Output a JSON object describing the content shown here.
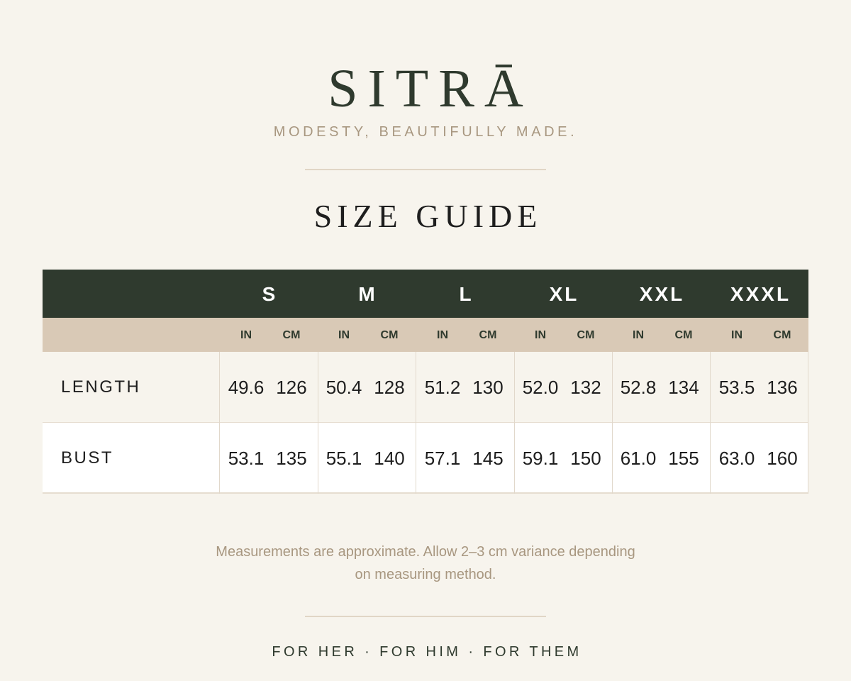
{
  "brand": {
    "name": "SITRĀ",
    "tagline": "MODESTY, BEAUTIFULLY MADE."
  },
  "page_title": "SIZE GUIDE",
  "table": {
    "sizes": [
      "S",
      "M",
      "L",
      "XL",
      "XXL",
      "XXXL"
    ],
    "units": {
      "in": "IN",
      "cm": "CM"
    },
    "rows": [
      {
        "label": "LENGTH",
        "values": [
          {
            "in": "49.6",
            "cm": "126"
          },
          {
            "in": "50.4",
            "cm": "128"
          },
          {
            "in": "51.2",
            "cm": "130"
          },
          {
            "in": "52.0",
            "cm": "132"
          },
          {
            "in": "52.8",
            "cm": "134"
          },
          {
            "in": "53.5",
            "cm": "136"
          }
        ]
      },
      {
        "label": "BUST",
        "values": [
          {
            "in": "53.1",
            "cm": "135"
          },
          {
            "in": "55.1",
            "cm": "140"
          },
          {
            "in": "57.1",
            "cm": "145"
          },
          {
            "in": "59.1",
            "cm": "150"
          },
          {
            "in": "61.0",
            "cm": "155"
          },
          {
            "in": "63.0",
            "cm": "160"
          }
        ]
      }
    ]
  },
  "note": "Measurements are approximate. Allow 2–3 cm variance depending on measuring method.",
  "footer": {
    "nav": "FOR HER · FOR HIM · FOR THEM"
  },
  "colors": {
    "background": "#f7f4ed",
    "brand_green": "#2f3a2e",
    "accent_tan": "#d9c9b6",
    "muted_text": "#a89780"
  }
}
